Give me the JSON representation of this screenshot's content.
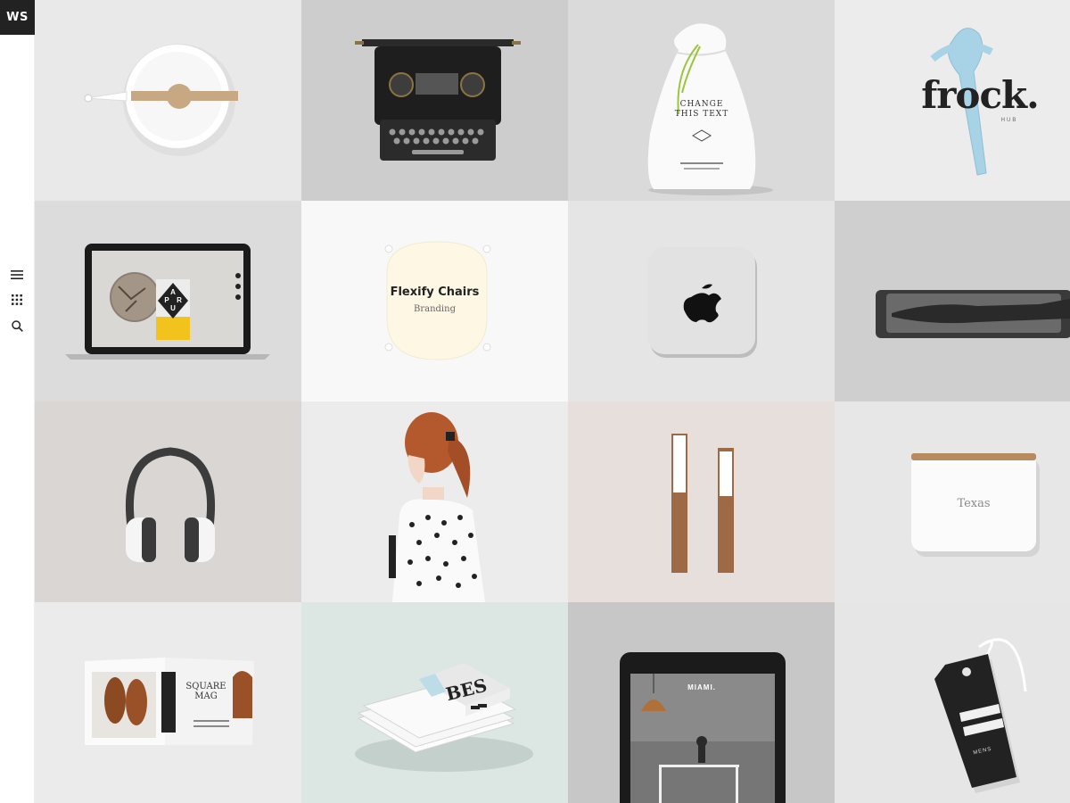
{
  "logo": {
    "text": "WS"
  },
  "sidebar": {
    "icons": [
      {
        "name": "menu-icon"
      },
      {
        "name": "grid-icon"
      },
      {
        "name": "search-icon"
      }
    ]
  },
  "portfolio": {
    "items": [
      {
        "name": "kettle",
        "bg": "#e9e9e9"
      },
      {
        "name": "typewriter",
        "bg": "#cdcdcd"
      },
      {
        "name": "bag",
        "bg": "#dadada",
        "text_line1": "CHANGE",
        "text_line2": "THIS TEXT"
      },
      {
        "name": "frock",
        "bg": "#ececec",
        "brand": "frock.",
        "sub": "HUB"
      },
      {
        "name": "laptop",
        "bg": "#dcdcdc",
        "letters": [
          "A",
          "P",
          "R",
          "U"
        ]
      },
      {
        "name": "chair",
        "bg": "#f8f8f8",
        "title": "Flexify Chairs",
        "category": "Branding"
      },
      {
        "name": "mac-mini",
        "bg": "#e5e5e5"
      },
      {
        "name": "stapler",
        "bg": "#cfcfcf"
      },
      {
        "name": "headphones",
        "bg": "#d9d6d3"
      },
      {
        "name": "girl",
        "bg": "#ececec"
      },
      {
        "name": "tubes",
        "bg": "#e6dfdc"
      },
      {
        "name": "box",
        "bg": "#e7e7e7",
        "label": "Texas"
      },
      {
        "name": "magazine",
        "bg": "#ebebeb",
        "line1": "SQUARE",
        "line2": "MAG"
      },
      {
        "name": "books",
        "bg": "#dce6e2",
        "cover": "BES"
      },
      {
        "name": "tablet",
        "bg": "#c7c7c7",
        "label": "MIAMI."
      },
      {
        "name": "tag",
        "bg": "#e6e6e6",
        "label": "MENS"
      }
    ]
  }
}
